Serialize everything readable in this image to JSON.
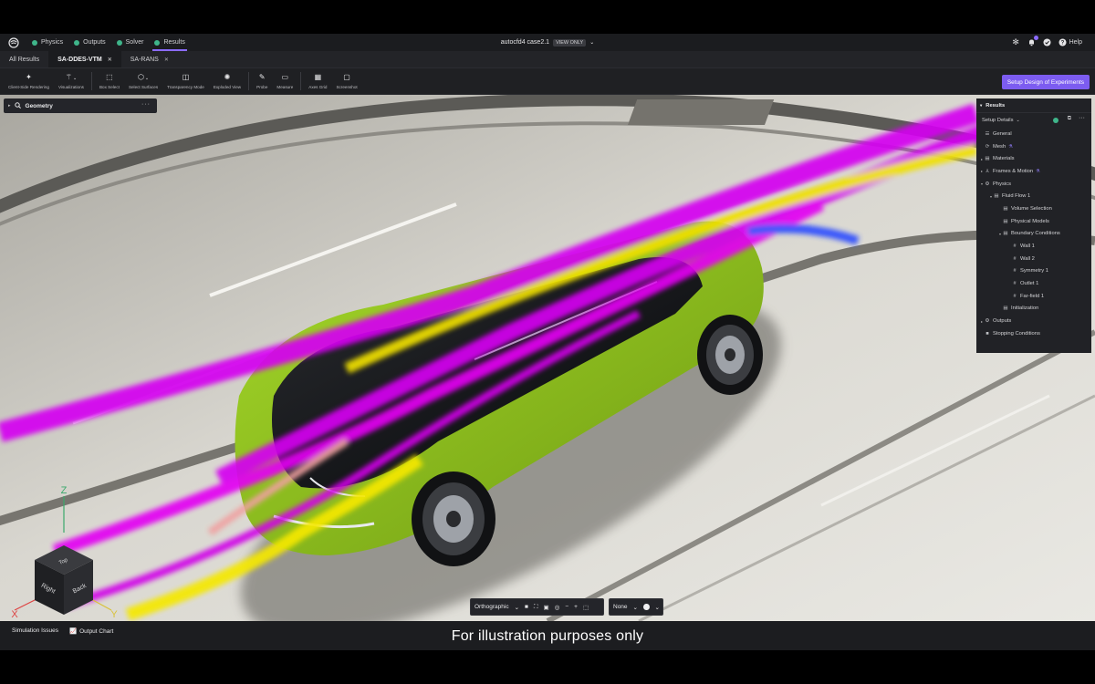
{
  "app": {
    "steps": [
      {
        "label": "Physics",
        "done": true
      },
      {
        "label": "Outputs",
        "done": true
      },
      {
        "label": "Solver",
        "done": true
      },
      {
        "label": "Results",
        "done": true,
        "active": true
      }
    ],
    "project_title": "autocfd4 case2.1",
    "view_badge": "VIEW ONLY",
    "help_label": "Help"
  },
  "tabs": [
    {
      "label": "All Results",
      "closable": false
    },
    {
      "label": "SA-DDES-VTM",
      "closable": true,
      "selected": true
    },
    {
      "label": "SA-RANS",
      "closable": true
    }
  ],
  "toolbar": {
    "tools": [
      {
        "label": "Client-Side Rendering",
        "icon": "sparkle-icon"
      },
      {
        "label": "Visualizations",
        "icon": "wand-icon"
      },
      {
        "label": "Box Select",
        "icon": "box-select-icon"
      },
      {
        "label": "Select Surfaces",
        "icon": "cube-icon"
      },
      {
        "label": "Transparency Mode",
        "icon": "transparency-icon"
      },
      {
        "label": "Exploded View",
        "icon": "exploded-icon"
      },
      {
        "label": "Probe",
        "icon": "probe-icon"
      },
      {
        "label": "Measure",
        "icon": "ruler-icon"
      },
      {
        "label": "Axes Grid",
        "icon": "grid-icon"
      },
      {
        "label": "Screenshot",
        "icon": "camera-icon"
      }
    ],
    "doe_button": "Setup Design of Experiments"
  },
  "geometry_panel": {
    "title": "Geometry"
  },
  "results_panel": {
    "title": "Results",
    "setup_details": "Setup Details",
    "tree": [
      {
        "label": "General",
        "icon": "sliders-icon",
        "depth": 0,
        "twisty": ""
      },
      {
        "label": "Mesh",
        "icon": "mesh-icon",
        "depth": 0,
        "twisty": "",
        "flask": true
      },
      {
        "label": "Materials",
        "icon": "materials-icon",
        "depth": 0,
        "twisty": "▸"
      },
      {
        "label": "Frames & Motion",
        "icon": "frames-icon",
        "depth": 0,
        "twisty": "▸",
        "flask": true
      },
      {
        "label": "Physics",
        "icon": "physics-icon",
        "depth": 0,
        "twisty": "▾"
      },
      {
        "label": "Fluid Flow 1",
        "icon": "fluid-icon",
        "depth": 1,
        "twisty": "▾"
      },
      {
        "label": "Volume Selection",
        "icon": "list-icon",
        "depth": 2,
        "twisty": ""
      },
      {
        "label": "Physical Models",
        "icon": "list-icon",
        "depth": 2,
        "twisty": ""
      },
      {
        "label": "Boundary Conditions",
        "icon": "list-icon",
        "depth": 2,
        "twisty": "▾"
      },
      {
        "label": "Wall 1",
        "icon": "hash-icon",
        "depth": 3,
        "twisty": ""
      },
      {
        "label": "Wall 2",
        "icon": "hash-icon",
        "depth": 3,
        "twisty": ""
      },
      {
        "label": "Symmetry 1",
        "icon": "hash-icon",
        "depth": 3,
        "twisty": ""
      },
      {
        "label": "Outlet 1",
        "icon": "hash-icon",
        "depth": 3,
        "twisty": ""
      },
      {
        "label": "Far-field 1",
        "icon": "hash-icon",
        "depth": 3,
        "twisty": ""
      },
      {
        "label": "Initialization",
        "icon": "list-icon",
        "depth": 2,
        "twisty": ""
      },
      {
        "label": "Outputs",
        "icon": "outputs-icon",
        "depth": 0,
        "twisty": "▸"
      },
      {
        "label": "Stopping Conditions",
        "icon": "stop-icon",
        "depth": 0,
        "twisty": ""
      }
    ]
  },
  "view_cube": {
    "top": "Top",
    "right": "Right",
    "back": "Back",
    "axis_x": "X",
    "axis_y": "Y",
    "axis_z": "Z"
  },
  "view_toolbar": {
    "projection": "Orthographic",
    "color_mode": "None"
  },
  "bottom": {
    "issues": "Simulation Issues",
    "chart": "Output Chart"
  },
  "caption": "For illustration purposes only",
  "colors": {
    "accent": "#7c5cf0",
    "ok": "#3fb58a",
    "car_body": "#8fc01c",
    "streamline_magenta": "#d400f0",
    "streamline_yellow": "#f0e000",
    "streamline_blue": "#2b4cff"
  }
}
